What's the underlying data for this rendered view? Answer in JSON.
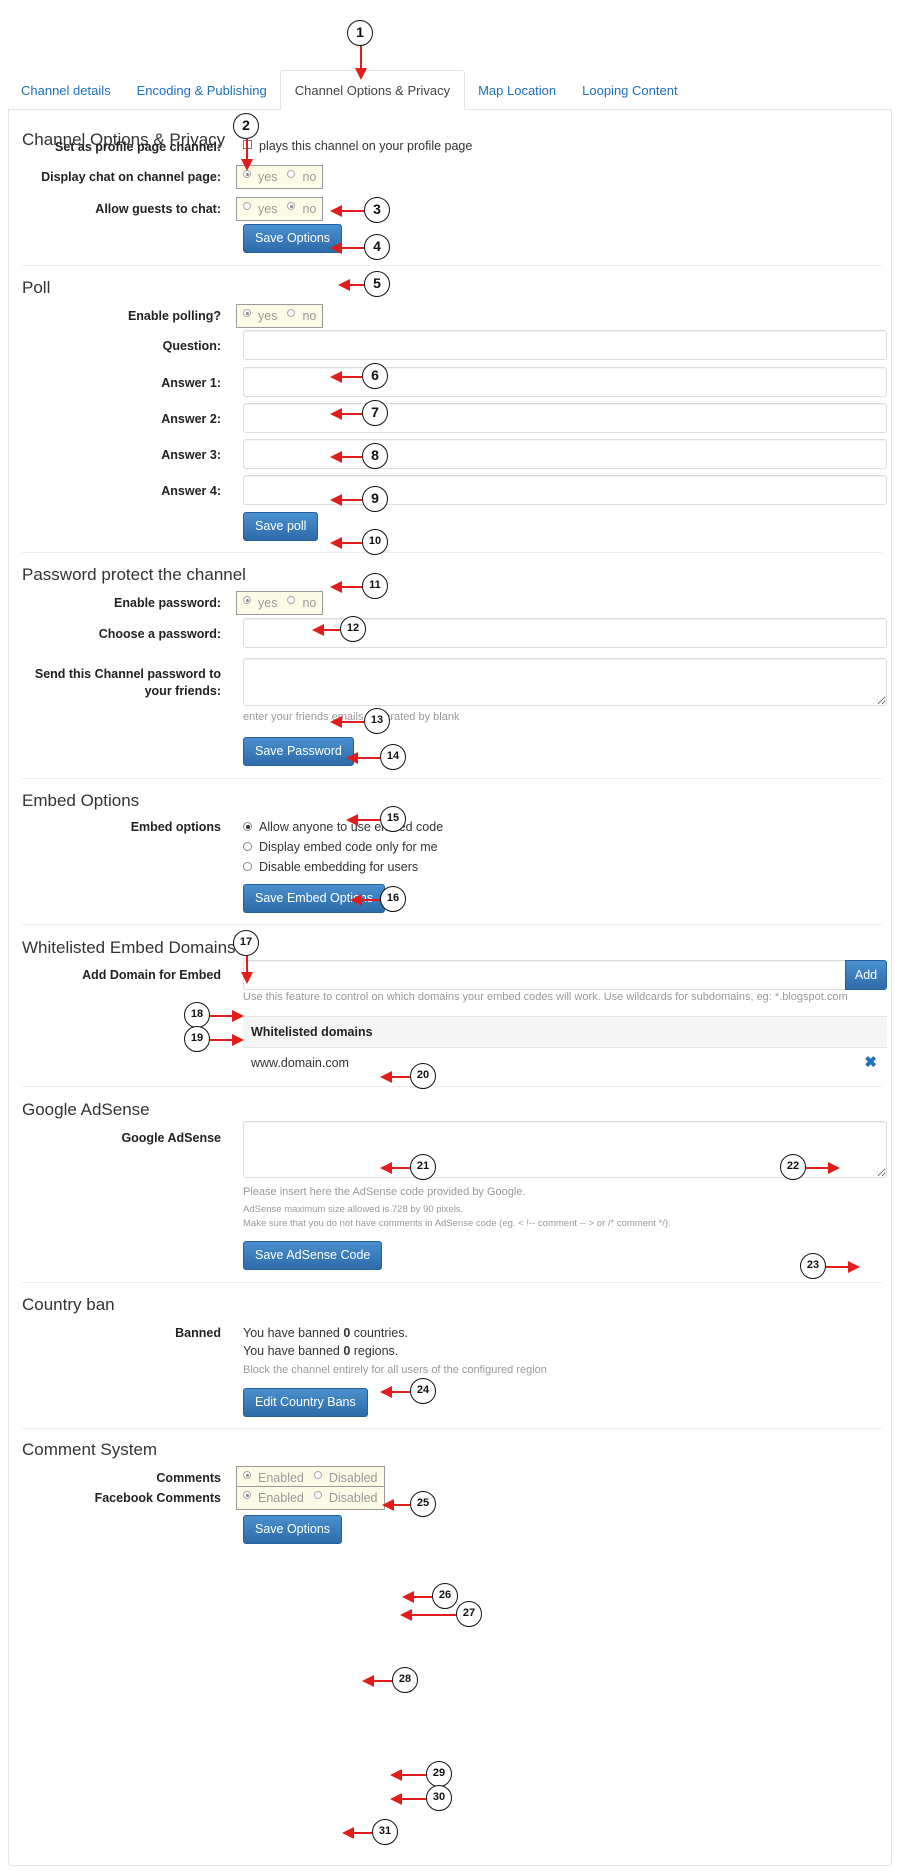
{
  "tabs": [
    {
      "label": "Channel details",
      "active": false
    },
    {
      "label": "Encoding & Publishing",
      "active": false
    },
    {
      "label": "Channel Options & Privacy",
      "active": true
    },
    {
      "label": "Map Location",
      "active": false
    },
    {
      "label": "Looping Content",
      "active": false
    }
  ],
  "options": {
    "title": "Channel Options & Privacy",
    "profile_label": "Set as profile page channel:",
    "profile_checkbox_text": "plays this channel on your profile page",
    "profile_checked": false,
    "chat_label": "Display chat on channel page:",
    "chat_yes": "yes",
    "chat_no": "no",
    "chat_value": "yes",
    "guests_label": "Allow guests to chat:",
    "guests_yes": "yes",
    "guests_no": "no",
    "guests_value": "no",
    "save_label": "Save Options"
  },
  "poll": {
    "title": "Poll",
    "enable_label": "Enable polling?",
    "enable_yes": "yes",
    "enable_no": "no",
    "enable_value": "yes",
    "question_label": "Question:",
    "question_value": "",
    "answer1_label": "Answer 1:",
    "answer1_value": "",
    "answer2_label": "Answer 2:",
    "answer2_value": "",
    "answer3_label": "Answer 3:",
    "answer3_value": "",
    "answer4_label": "Answer 4:",
    "answer4_value": "",
    "save_label": "Save poll"
  },
  "password": {
    "title": "Password protect the channel",
    "enable_label": "Enable password:",
    "enable_yes": "yes",
    "enable_no": "no",
    "enable_value": "yes",
    "choose_label": "Choose a password:",
    "choose_value": "",
    "send_label_line1": "Send this Channel password to",
    "send_label_line2": "your friends:",
    "send_value": "",
    "send_help": "enter your friends emails separated by blank",
    "save_label": "Save Password"
  },
  "embed": {
    "title": "Embed Options",
    "label": "Embed options",
    "options": [
      {
        "label": "Allow anyone to use embed code",
        "selected": true
      },
      {
        "label": "Display embed code only for me",
        "selected": false
      },
      {
        "label": "Disable embedding for users",
        "selected": false
      }
    ],
    "save_label": "Save Embed Options"
  },
  "whitelist": {
    "title": "Whitelisted Embed Domains",
    "add_label": "Add Domain for Embed",
    "add_value": "",
    "add_button": "Add",
    "help": "Use this feature to control on which domains your embed codes will work. Use wildcards for subdomains, eg: *.blogspot.com",
    "table_header": "Whitelisted domains",
    "domains": [
      "www.domain.com"
    ],
    "remove_icon": "✖"
  },
  "adsense": {
    "title": "Google AdSense",
    "label": "Google AdSense",
    "value": "",
    "help1": "Please insert here the AdSense code provided by Google.",
    "help2": "AdSense maximum size allowed is 728 by 90 pixels.",
    "help3": "Make sure that you do not have comments in AdSense code (eg. < !-- comment -- > or /* comment */).",
    "save_label": "Save AdSense Code"
  },
  "country": {
    "title": "Country ban",
    "label": "Banned",
    "countries_prefix": "You have banned ",
    "countries_count": "0",
    "countries_suffix": " countries.",
    "regions_prefix": "You have banned ",
    "regions_count": "0",
    "regions_suffix": " regions.",
    "help": "Block the channel entirely for all users of the configured region",
    "edit_label": "Edit Country Bans"
  },
  "comments": {
    "title": "Comment System",
    "comments_label": "Comments",
    "comments_enabled": "Enabled",
    "comments_disabled": "Disabled",
    "comments_value": "Enabled",
    "fb_label": "Facebook Comments",
    "fb_enabled": "Enabled",
    "fb_disabled": "Disabled",
    "fb_value": "Enabled",
    "save_label": "Save Options"
  },
  "callouts": [
    "1",
    "2",
    "3",
    "4",
    "5",
    "6",
    "7",
    "8",
    "9",
    "10",
    "11",
    "12",
    "13",
    "14",
    "15",
    "16",
    "17",
    "18",
    "19",
    "20",
    "21",
    "22",
    "23",
    "24",
    "25",
    "26",
    "27",
    "28",
    "29",
    "30",
    "31"
  ]
}
